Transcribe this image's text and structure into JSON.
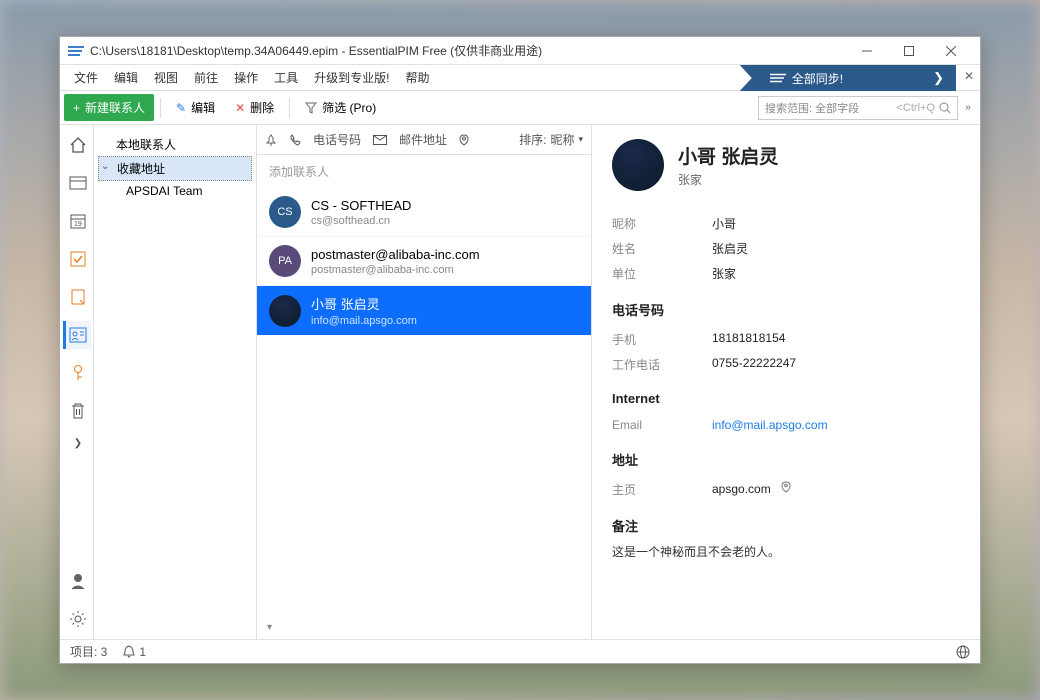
{
  "window": {
    "title": "C:\\Users\\18181\\Desktop\\temp.34A06449.epim - EssentialPIM Free (仅供非商业用途)"
  },
  "menu": {
    "items": [
      "文件",
      "编辑",
      "视图",
      "前往",
      "操作",
      "工具",
      "升级到专业版!",
      "帮助"
    ],
    "sync_banner": "全部同步!"
  },
  "toolbar": {
    "new_label": "新建联系人",
    "edit_label": "编辑",
    "delete_label": "删除",
    "filter_label": "筛选 (Pro)"
  },
  "search": {
    "placeholder": "搜索范围: 全部字段",
    "shortcut": "<Ctrl+Q"
  },
  "tree": {
    "root": "本地联系人",
    "favorites": "收藏地址",
    "items": [
      "APSDAI Team"
    ]
  },
  "list": {
    "header_phone": "电话号码",
    "header_mail": "邮件地址",
    "sort_label": "排序:",
    "sort_field": "昵称",
    "add_placeholder": "添加联系人",
    "contacts": [
      {
        "initials": "CS",
        "name": "CS - SOFTHEAD",
        "email": "cs@softhead.cn",
        "avatar_class": "cs"
      },
      {
        "initials": "PA",
        "name": "postmaster@alibaba-inc.com",
        "email": "postmaster@alibaba-inc.com",
        "avatar_class": "pa"
      },
      {
        "initials": "",
        "name": "小哥 张启灵",
        "email": "info@mail.apsgo.com",
        "avatar_class": "photo",
        "selected": true
      }
    ]
  },
  "detail": {
    "name": "小哥 张启灵",
    "company": "张家",
    "fields": {
      "nickname_label": "昵称",
      "nickname_value": "小哥",
      "fullname_label": "姓名",
      "fullname_value": "张启灵",
      "company_label": "单位",
      "company_value": "张家"
    },
    "phone_section": "电话号码",
    "phones": [
      {
        "label": "手机",
        "value": "18181818154"
      },
      {
        "label": "工作电话",
        "value": "0755-22222247"
      }
    ],
    "internet_section": "Internet",
    "email_label": "Email",
    "email_value": "info@mail.apsgo.com",
    "address_section": "地址",
    "homepage_label": "主页",
    "homepage_value": "apsgo.com",
    "notes_section": "备注",
    "notes_text": "这是一个神秘而且不会老的人。"
  },
  "statusbar": {
    "items_label": "项目: 3",
    "bell_count": "1"
  }
}
